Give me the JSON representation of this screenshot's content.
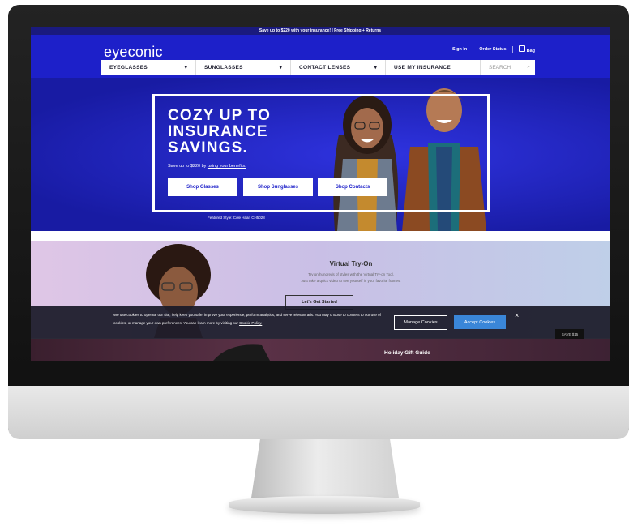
{
  "promo": {
    "text": "Save up to $220 with your insurance! | Free Shipping + Returns"
  },
  "brand": {
    "logo_text": "eyeconic",
    "accent_color": "#1d20c9"
  },
  "header_links": {
    "sign_in": "Sign In",
    "order_status": "Order Status",
    "bag": "Bag",
    "bag_icon": "bag-icon"
  },
  "nav": {
    "items": [
      {
        "label": "EYEGLASSES",
        "caret": "▾"
      },
      {
        "label": "SUNGLASSES",
        "caret": "▾"
      },
      {
        "label": "CONTACT LENSES",
        "caret": "▾"
      },
      {
        "label": "USE MY INSURANCE",
        "caret": ""
      }
    ],
    "search_placeholder": "SEARCH",
    "search_icon": "search-icon"
  },
  "hero": {
    "headline_1": "COZY UP TO",
    "headline_2": "INSURANCE",
    "headline_3": "SAVINGS.",
    "sub_before": "Save up to $220 by ",
    "sub_link": "using your benefits.",
    "buttons": [
      "Shop Glasses",
      "Shop Sunglasses",
      "Shop Contacts"
    ],
    "featured": "Featured Style: Cole Haan CH5028"
  },
  "vto": {
    "title": "Virtual Try-On",
    "line_1": "Try on hundreds of styles with the Virtual Try-on Tool.",
    "line_2": "Just take a quick video to see yourself in your favorite frames.",
    "button": "Let's Get Started"
  },
  "cookie": {
    "text": "We use cookies to operate our site, help keep you safe, improve your experience, perform analytics, and serve relevant ads. You may choose to consent to our use of cookies, or manage your own preferences. You can learn more by visiting our ",
    "link": "Cookie Policy.",
    "manage": "Manage Cookies",
    "accept": "Accept Cookies",
    "close": "×",
    "badge": "SAVE $15"
  },
  "gift": {
    "title": "Holiday Gift Guide"
  }
}
